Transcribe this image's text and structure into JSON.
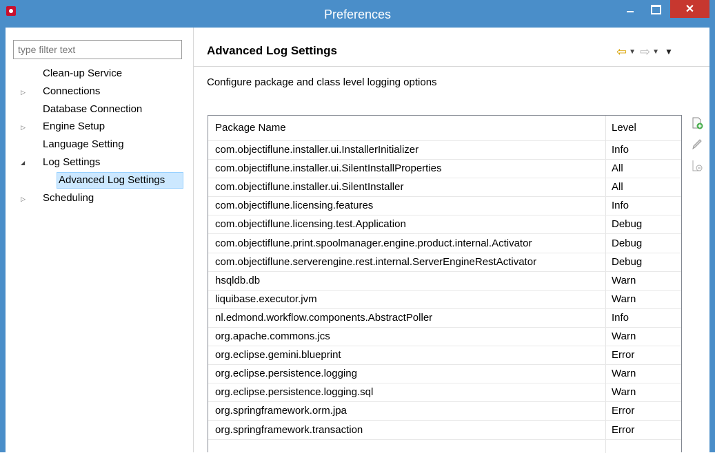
{
  "window": {
    "title": "Preferences",
    "close_glyph": "✕"
  },
  "filter": {
    "placeholder": "type filter text"
  },
  "tree": [
    {
      "label": "Clean-up Service",
      "expandable": false
    },
    {
      "label": "Connections",
      "expandable": true,
      "expanded": false
    },
    {
      "label": "Database Connection",
      "expandable": false
    },
    {
      "label": "Engine Setup",
      "expandable": true,
      "expanded": false
    },
    {
      "label": "Language Setting",
      "expandable": false
    },
    {
      "label": "Log Settings",
      "expandable": true,
      "expanded": true
    },
    {
      "label": "Advanced Log Settings",
      "expandable": false,
      "selected": true
    },
    {
      "label": "Scheduling",
      "expandable": true,
      "expanded": false
    }
  ],
  "page": {
    "title": "Advanced Log Settings",
    "description": "Configure package and class level logging options"
  },
  "table": {
    "columns": [
      "Package Name",
      "Level"
    ],
    "rows": [
      [
        "com.objectiflune.installer.ui.InstallerInitializer",
        "Info"
      ],
      [
        "com.objectiflune.installer.ui.SilentInstallProperties",
        "All"
      ],
      [
        "com.objectiflune.installer.ui.SilentInstaller",
        "All"
      ],
      [
        "com.objectiflune.licensing.features",
        "Info"
      ],
      [
        "com.objectiflune.licensing.test.Application",
        "Debug"
      ],
      [
        "com.objectiflune.print.spoolmanager.engine.product.internal.Activator",
        "Debug"
      ],
      [
        "com.objectiflune.serverengine.rest.internal.ServerEngineRestActivator",
        "Debug"
      ],
      [
        "hsqldb.db",
        "Warn"
      ],
      [
        "liquibase.executor.jvm",
        "Warn"
      ],
      [
        "nl.edmond.workflow.components.AbstractPoller",
        "Info"
      ],
      [
        "org.apache.commons.jcs",
        "Warn"
      ],
      [
        "org.eclipse.gemini.blueprint",
        "Error"
      ],
      [
        "org.eclipse.persistence.logging",
        "Warn"
      ],
      [
        "org.eclipse.persistence.logging.sql",
        "Warn"
      ],
      [
        "org.springframework.orm.jpa",
        "Error"
      ],
      [
        "org.springframework.transaction",
        "Error"
      ]
    ]
  },
  "colors": {
    "titlebar": "#4a8ec9",
    "close_button": "#c7372f",
    "selection": "#cce8ff",
    "nav_arrow": "#d9a200"
  },
  "icons": {
    "app": "app-icon",
    "back": "back-arrow-icon",
    "forward": "forward-arrow-icon",
    "add": "add-entry-icon",
    "edit": "edit-entry-icon",
    "remove": "remove-entry-icon"
  }
}
